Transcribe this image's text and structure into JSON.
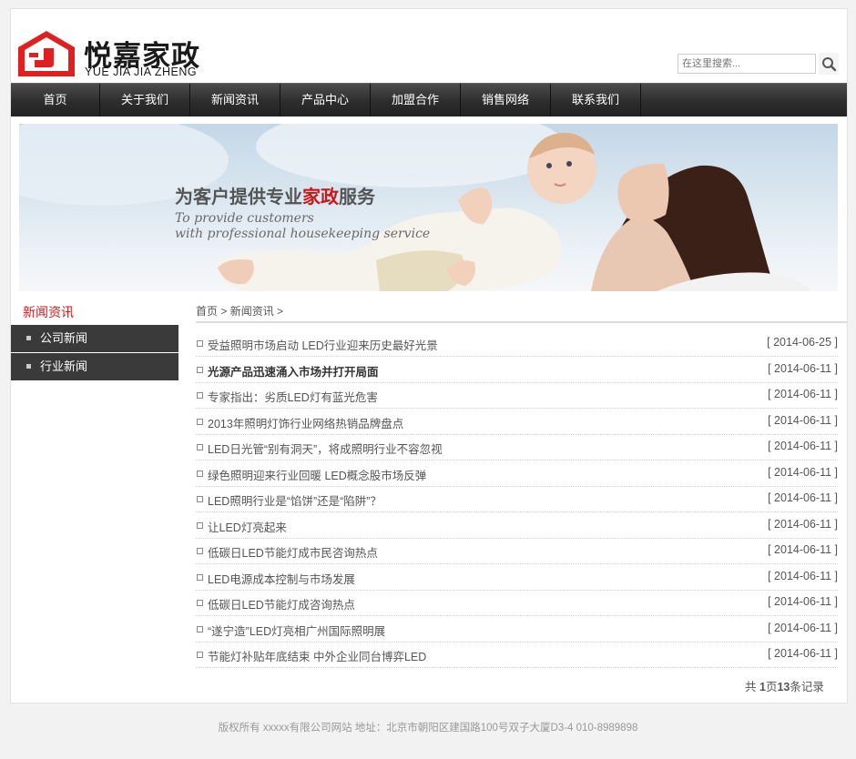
{
  "header": {
    "brand_cn": "悦嘉家政",
    "brand_en": "YUE JIA JIA ZHENG",
    "search_placeholder": "在这里搜索...",
    "brand_color": "#e02020"
  },
  "nav": [
    "首页",
    "关于我们",
    "新闻资讯",
    "产品中心",
    "加盟合作",
    "销售网络",
    "联系我们"
  ],
  "banner": {
    "title_prefix": "为客户提供专业",
    "title_highlight": "家政",
    "title_suffix": "服务",
    "subtitle_line1": "To provide customers",
    "subtitle_line2": "with professional housekeeping service"
  },
  "sidebar": {
    "title": "新闻资讯",
    "items": [
      "公司新闻",
      "行业新闻"
    ]
  },
  "breadcrumb": {
    "home": "首页",
    "sep1": " > ",
    "section": "新闻资讯",
    "sep2": " >"
  },
  "news": [
    {
      "title": "受益照明市场启动 LED行业迎来历史最好光景",
      "date": "[ 2014-06-25 ]",
      "bold": false
    },
    {
      "title": "光源产品迅速涌入市场并打开局面",
      "date": "[ 2014-06-11 ]",
      "bold": true
    },
    {
      "title": "专家指出：劣质LED灯有蓝光危害",
      "date": "[ 2014-06-11 ]",
      "bold": false
    },
    {
      "title": "2013年照明灯饰行业网络热销品牌盘点",
      "date": "[ 2014-06-11 ]",
      "bold": false
    },
    {
      "title": "LED日光管“别有洞天”，将成照明行业不容忽视",
      "date": "[ 2014-06-11 ]",
      "bold": false
    },
    {
      "title": "绿色照明迎来行业回暖 LED概念股市场反弹",
      "date": "[ 2014-06-11 ]",
      "bold": false
    },
    {
      "title": "LED照明行业是“馅饼”还是“陷阱”？",
      "date": "[ 2014-06-11 ]",
      "bold": false
    },
    {
      "title": "让LED灯亮起来",
      "date": "[ 2014-06-11 ]",
      "bold": false
    },
    {
      "title": "低碳日LED节能灯成市民咨询热点",
      "date": "[ 2014-06-11 ]",
      "bold": false
    },
    {
      "title": "LED电源成本控制与市场发展",
      "date": "[ 2014-06-11 ]",
      "bold": false
    },
    {
      "title": "低碳日LED节能灯成咨询热点",
      "date": "[ 2014-06-11 ]",
      "bold": false
    },
    {
      "title": "“遂宁造”LED灯亮相广州国际照明展",
      "date": "[ 2014-06-11 ]",
      "bold": false
    },
    {
      "title": "节能灯补贴年底结束 中外企业同台博弈LED",
      "date": "[ 2014-06-11 ]",
      "bold": false
    }
  ],
  "pager": {
    "prefix": "共 ",
    "pages": "1",
    "mid": "页",
    "count": "13",
    "suffix": "条记录"
  },
  "footer": "版权所有 xxxxx有限公司网站 地址：北京市朝阳区建国路100号双子大厦D3-4 010-8989898"
}
